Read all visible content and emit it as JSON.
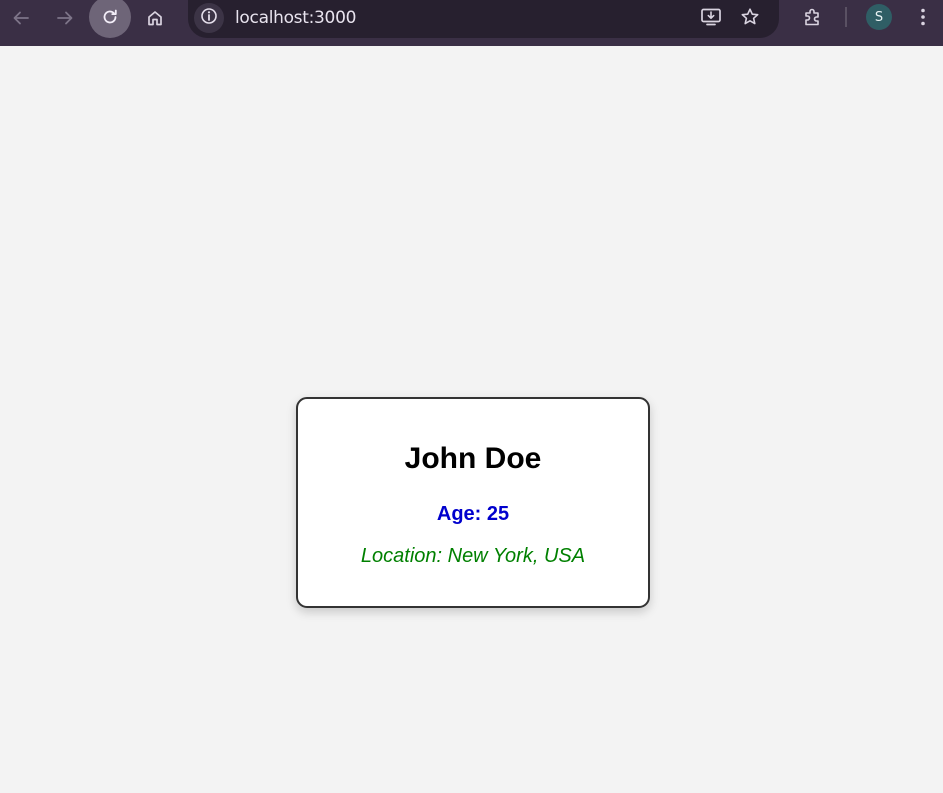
{
  "browser": {
    "url": "localhost:3000",
    "profile_initial": "S",
    "icons": {
      "back": "arrow-left-icon",
      "forward": "arrow-right-icon",
      "reload": "reload-icon",
      "home": "home-icon",
      "site_info": "info-icon",
      "install": "install-app-icon",
      "bookmark": "star-icon",
      "extensions": "puzzle-icon",
      "menu": "more-vertical-icon"
    },
    "colors": {
      "toolbar": "#3a2f45",
      "omnibox": "#27202f"
    }
  },
  "card": {
    "name": "John Doe",
    "age_line": "Age: 25",
    "location_line": "Location: New York, USA",
    "colors": {
      "name": "#000000",
      "age": "#0000cd",
      "location": "#008000",
      "background": "#ffffff",
      "border": "#333333"
    }
  },
  "page": {
    "background": "#f3f3f3"
  }
}
